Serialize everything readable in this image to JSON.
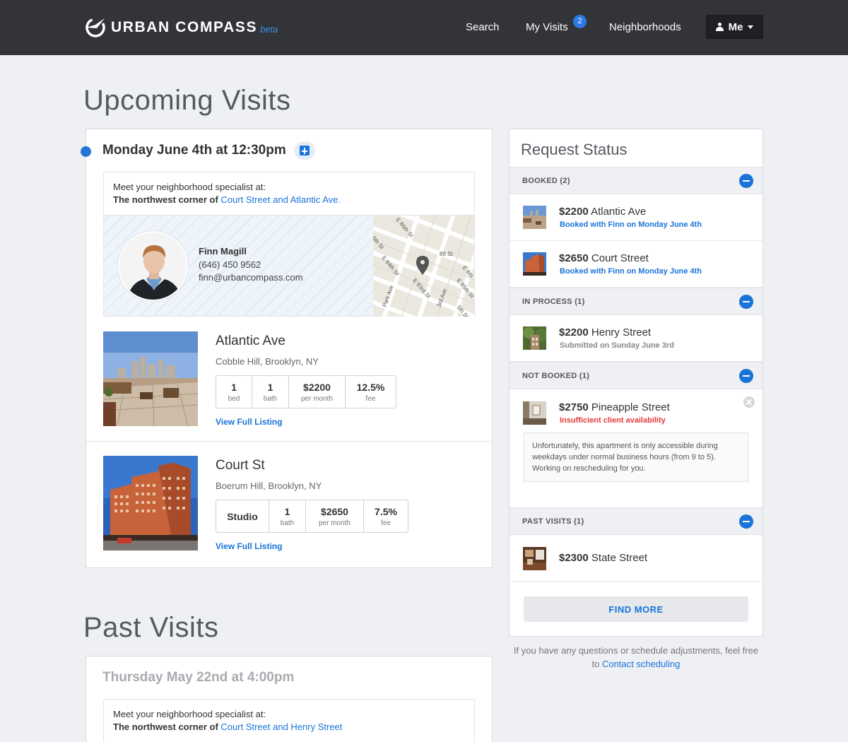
{
  "header": {
    "brand": "URBAN COMPASS",
    "beta": "beta",
    "nav": {
      "search": "Search",
      "my_visits": "My Visits",
      "my_visits_badge": "2",
      "neighborhoods": "Neighborhoods",
      "me": "Me"
    }
  },
  "upcoming": {
    "title": "Upcoming Visits",
    "visit": {
      "date": "Monday June 4th at 12:30pm",
      "meet_intro": "Meet your neighborhood specialist at:",
      "meet_prefix": "The northwest corner of",
      "meet_location": "Court Street and Atlantic Ave.",
      "specialist": {
        "name": "Finn Magill",
        "phone": "(646) 450 9562",
        "email": "finn@urbancompass.com"
      },
      "map_labels": [
        "E 86th St",
        "86 St",
        "E 86t",
        "E 85th St",
        "E 84th St",
        "E 83rd St",
        "Park Ave",
        "3rd Ave",
        "5th St",
        "6th St"
      ],
      "listings": [
        {
          "name": "Atlantic Ave",
          "location": "Cobble Hill, Brooklyn, NY",
          "stats": [
            {
              "value": "1",
              "label": "bed"
            },
            {
              "value": "1",
              "label": "bath"
            },
            {
              "value": "$2200",
              "label": "per month"
            },
            {
              "value": "12.5%",
              "label": "fee"
            }
          ],
          "link": "View Full Listing"
        },
        {
          "name": "Court St",
          "location": "Boerum Hill, Brooklyn, NY",
          "stats": [
            {
              "value": "Studio",
              "label": ""
            },
            {
              "value": "1",
              "label": "bath"
            },
            {
              "value": "$2650",
              "label": "per month"
            },
            {
              "value": "7.5%",
              "label": "fee"
            }
          ],
          "link": "View Full Listing"
        }
      ]
    }
  },
  "past": {
    "title": "Past Visits",
    "visit": {
      "date": "Thursday May 22nd at 4:00pm",
      "meet_intro": "Meet your neighborhood specialist at:",
      "meet_prefix": "The northwest corner of",
      "meet_location": "Court Street and Henry Street"
    }
  },
  "request_status": {
    "title": "Request Status",
    "groups": {
      "booked": {
        "label": "BOOKED (2)",
        "items": [
          {
            "price": "$2200",
            "street": "Atlantic Ave",
            "sub": "Booked with Finn on Monday June 4th"
          },
          {
            "price": "$2650",
            "street": "Court Street",
            "sub": "Booked with Finn on Monday June 4th"
          }
        ]
      },
      "in_process": {
        "label": "IN PROCESS (1)",
        "items": [
          {
            "price": "$2200",
            "street": "Henry Street",
            "sub": "Submitted on Sunday June 3rd"
          }
        ]
      },
      "not_booked": {
        "label": "NOT BOOKED (1)",
        "items": [
          {
            "price": "$2750",
            "street": "Pineapple Street",
            "sub": "Insufficient client availability",
            "note": "Unfortunately, this apartment is only accessible during weekdays under normal business hours (from 9 to 5). Working on rescheduling for you."
          }
        ]
      },
      "past_visits": {
        "label": "PAST VISITS (1)",
        "items": [
          {
            "price": "$2300",
            "street": "State Street"
          }
        ]
      }
    },
    "find_more": "FIND MORE",
    "help_prefix": "If you have any questions or schedule adjustments, feel free to",
    "help_link": "Contact scheduling"
  },
  "colors": {
    "accent": "#1a73d9",
    "topbar": "#323438",
    "background": "#eff0f4",
    "error": "#e33b3b"
  },
  "icons": [
    "compass-logo-icon",
    "person-icon",
    "caret-down-icon",
    "calendar-add-icon",
    "map-pin-icon",
    "collapse-minus-icon",
    "dismiss-x-icon"
  ]
}
